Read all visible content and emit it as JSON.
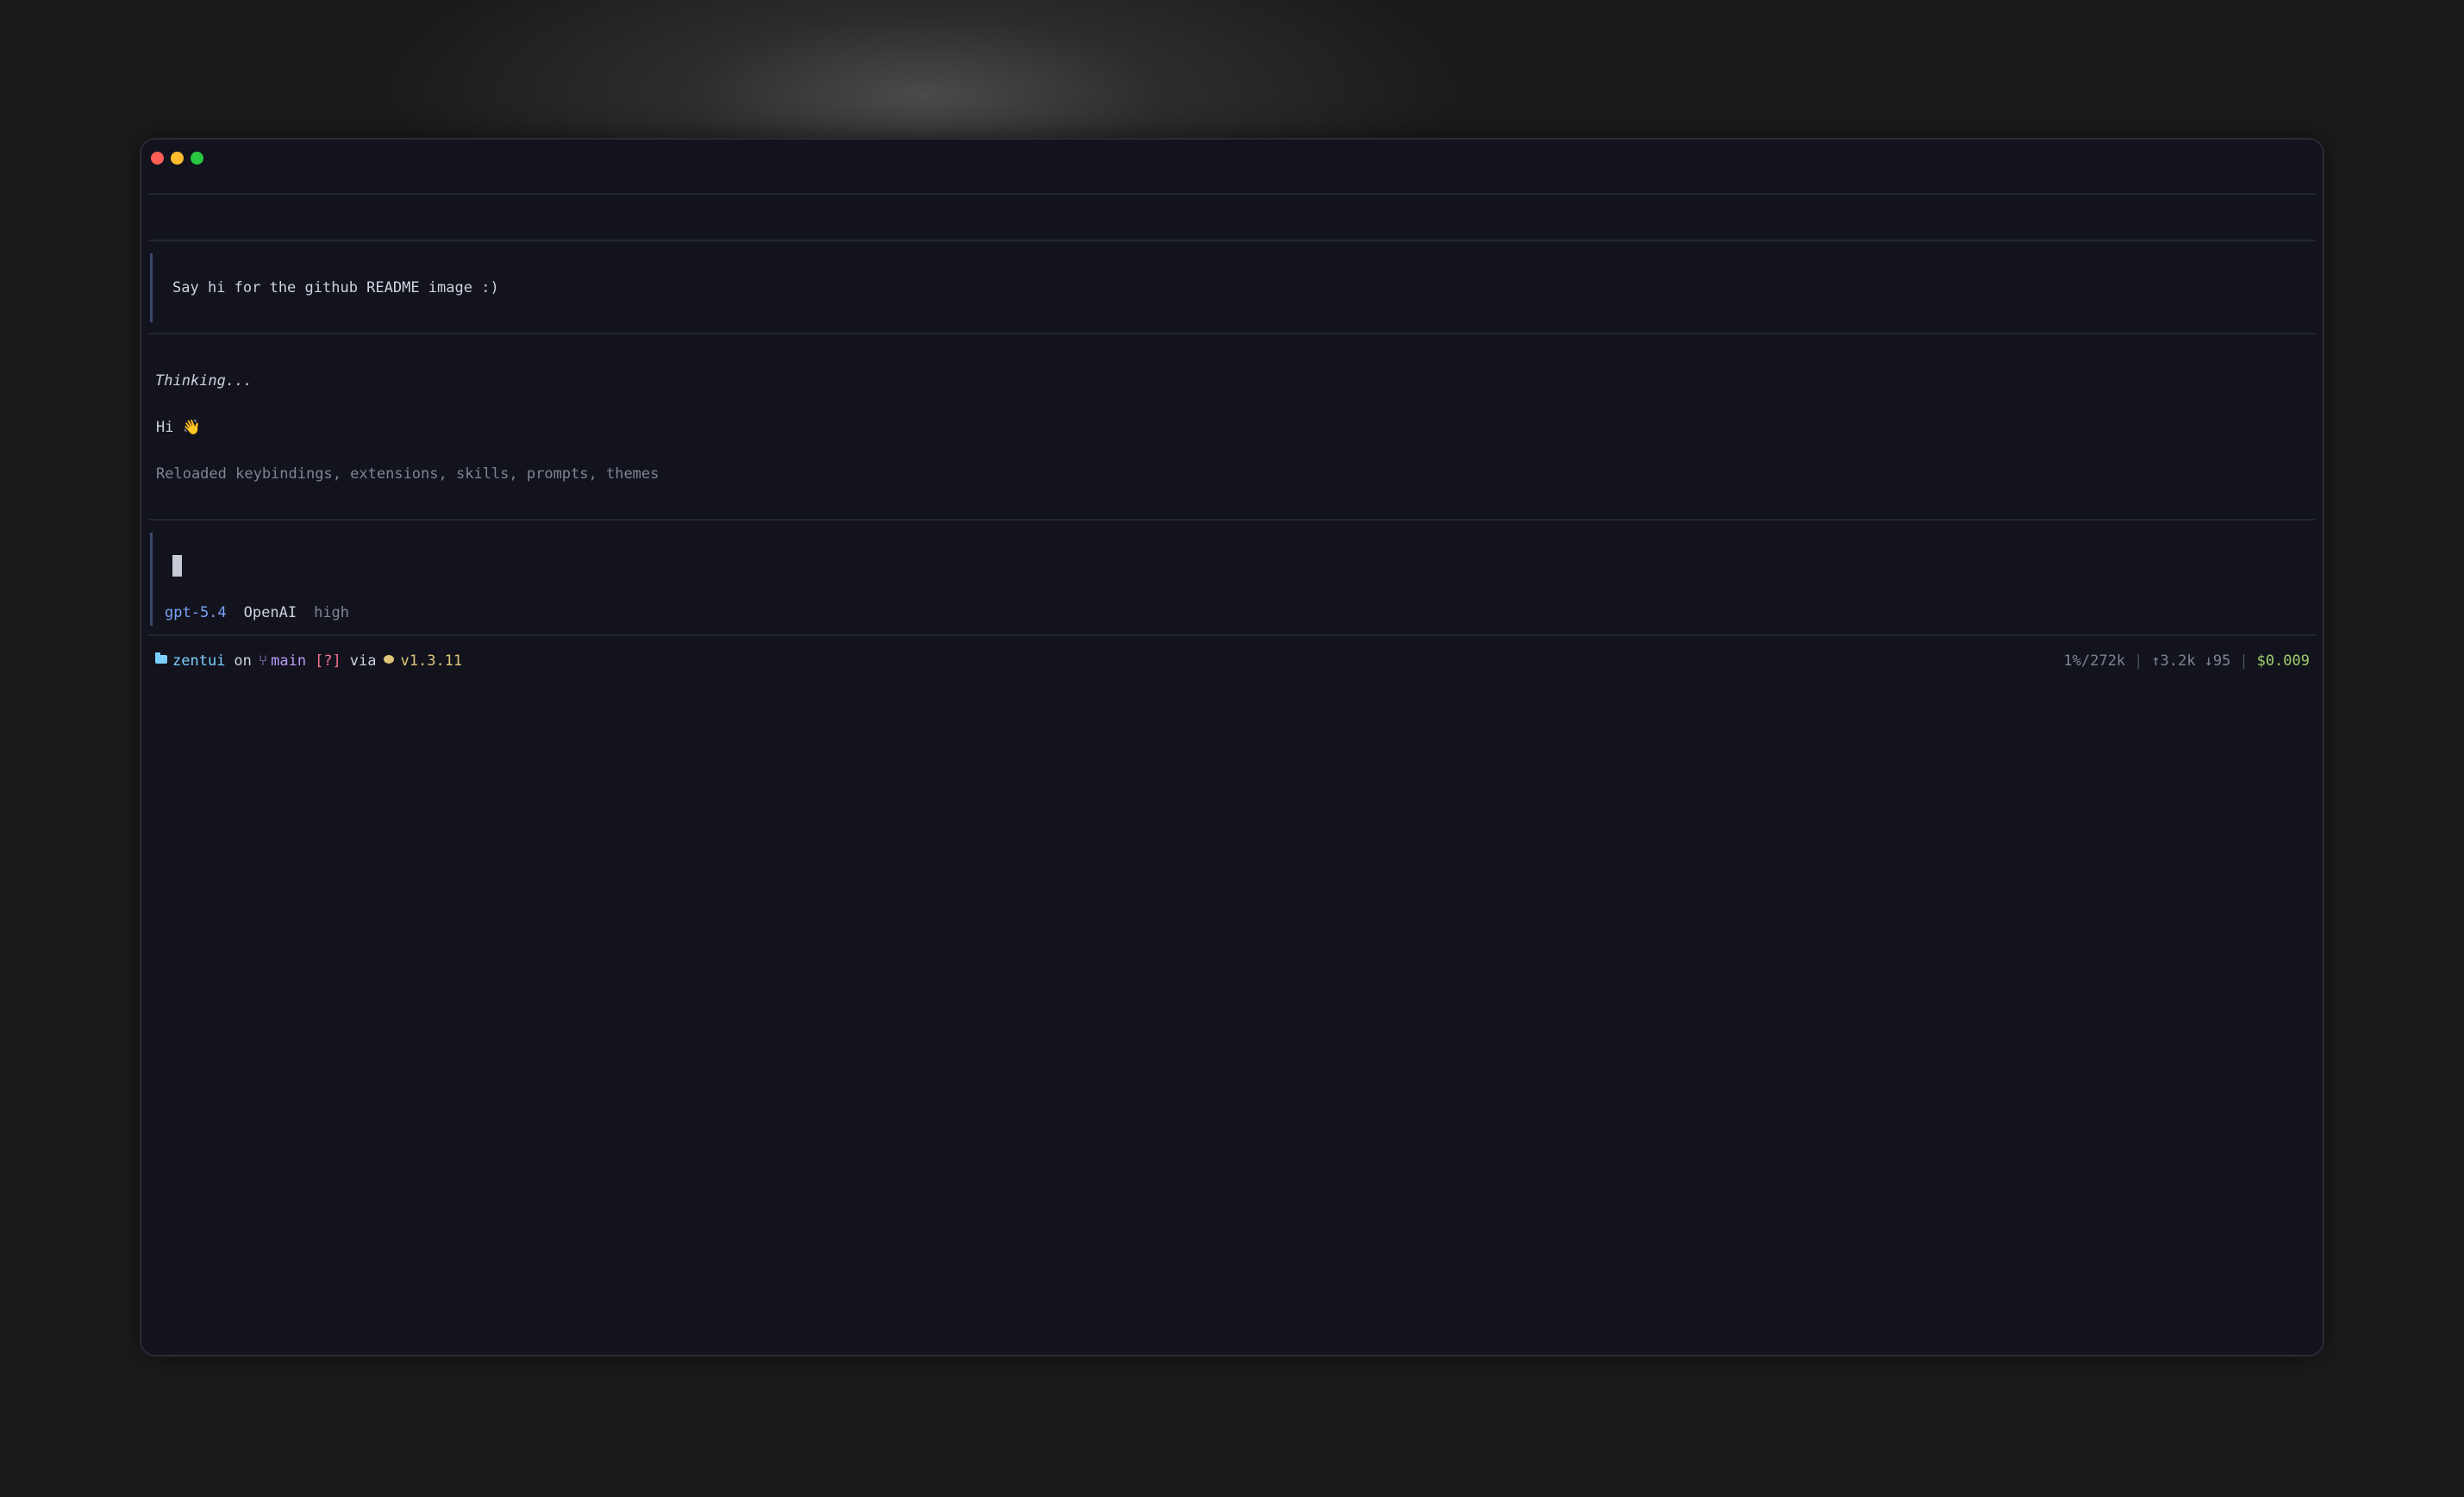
{
  "window": {
    "controls": [
      "close",
      "minimize",
      "maximize"
    ]
  },
  "conversation": {
    "user_message": "Say hi for the github README image :)",
    "thinking": "Thinking...",
    "assistant_reply": "Hi 👋",
    "system_notice": "Reloaded keybindings, extensions, skills, prompts, themes"
  },
  "input": {
    "value": ""
  },
  "model_bar": {
    "model": "gpt-5.4",
    "provider": "OpenAI",
    "effort": "high"
  },
  "status_bar": {
    "directory": "zentui",
    "on_word": "on",
    "branch": "main",
    "git_status": "[?]",
    "via_word": "via",
    "runtime_version": "v1.3.11",
    "context": "1%/272k",
    "tokens_up": "↑3.2k",
    "tokens_down": "↓95",
    "cost": "$0.009"
  },
  "icons": {
    "folder": "folder-icon",
    "branch": "git-branch-icon",
    "runtime": "bun-icon"
  },
  "colors": {
    "background": "#12131d",
    "accent_blue": "#7aa2f7",
    "accent_cyan": "#7dcfff",
    "accent_purple": "#bb9af7",
    "accent_pink": "#f7768e",
    "accent_yellow": "#e0c67a",
    "accent_green": "#9ece6a"
  }
}
